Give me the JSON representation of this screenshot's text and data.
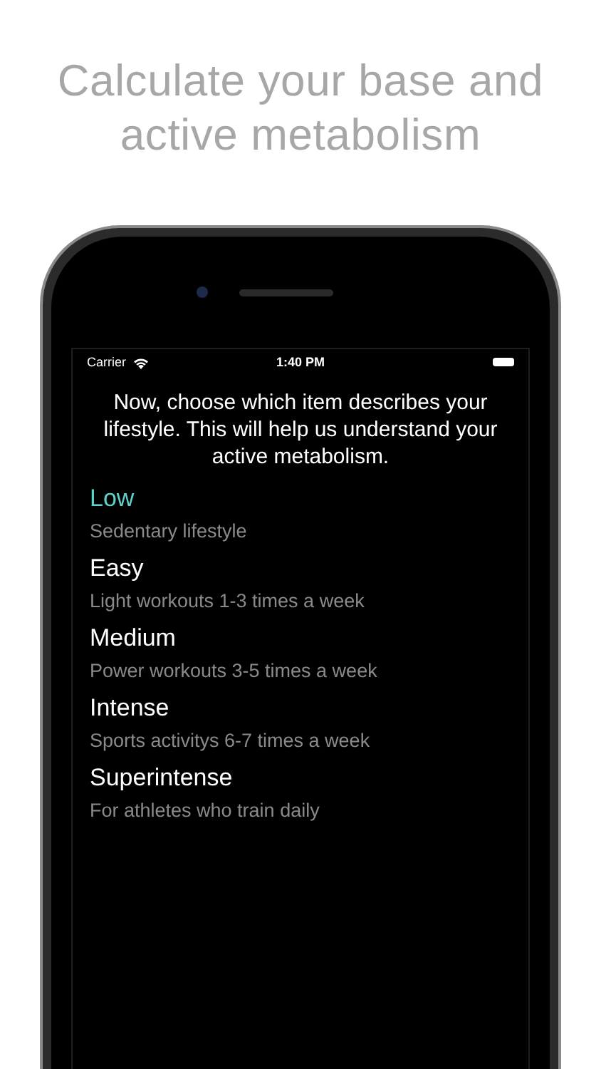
{
  "headline": "Calculate your base and active metabolism",
  "status_bar": {
    "carrier": "Carrier",
    "time": "1:40 PM"
  },
  "prompt": "Now, choose which item describes your lifestyle. This will help us understand your active metabolism.",
  "options": [
    {
      "title": "Low",
      "subtitle": "Sedentary lifestyle",
      "selected": true
    },
    {
      "title": "Easy",
      "subtitle": "Light workouts 1-3 times a week",
      "selected": false
    },
    {
      "title": "Medium",
      "subtitle": "Power workouts 3-5 times a week",
      "selected": false
    },
    {
      "title": "Intense",
      "subtitle": "Sports activitys 6-7 times a week",
      "selected": false
    },
    {
      "title": "Superintense",
      "subtitle": "For athletes who train daily",
      "selected": false
    }
  ]
}
